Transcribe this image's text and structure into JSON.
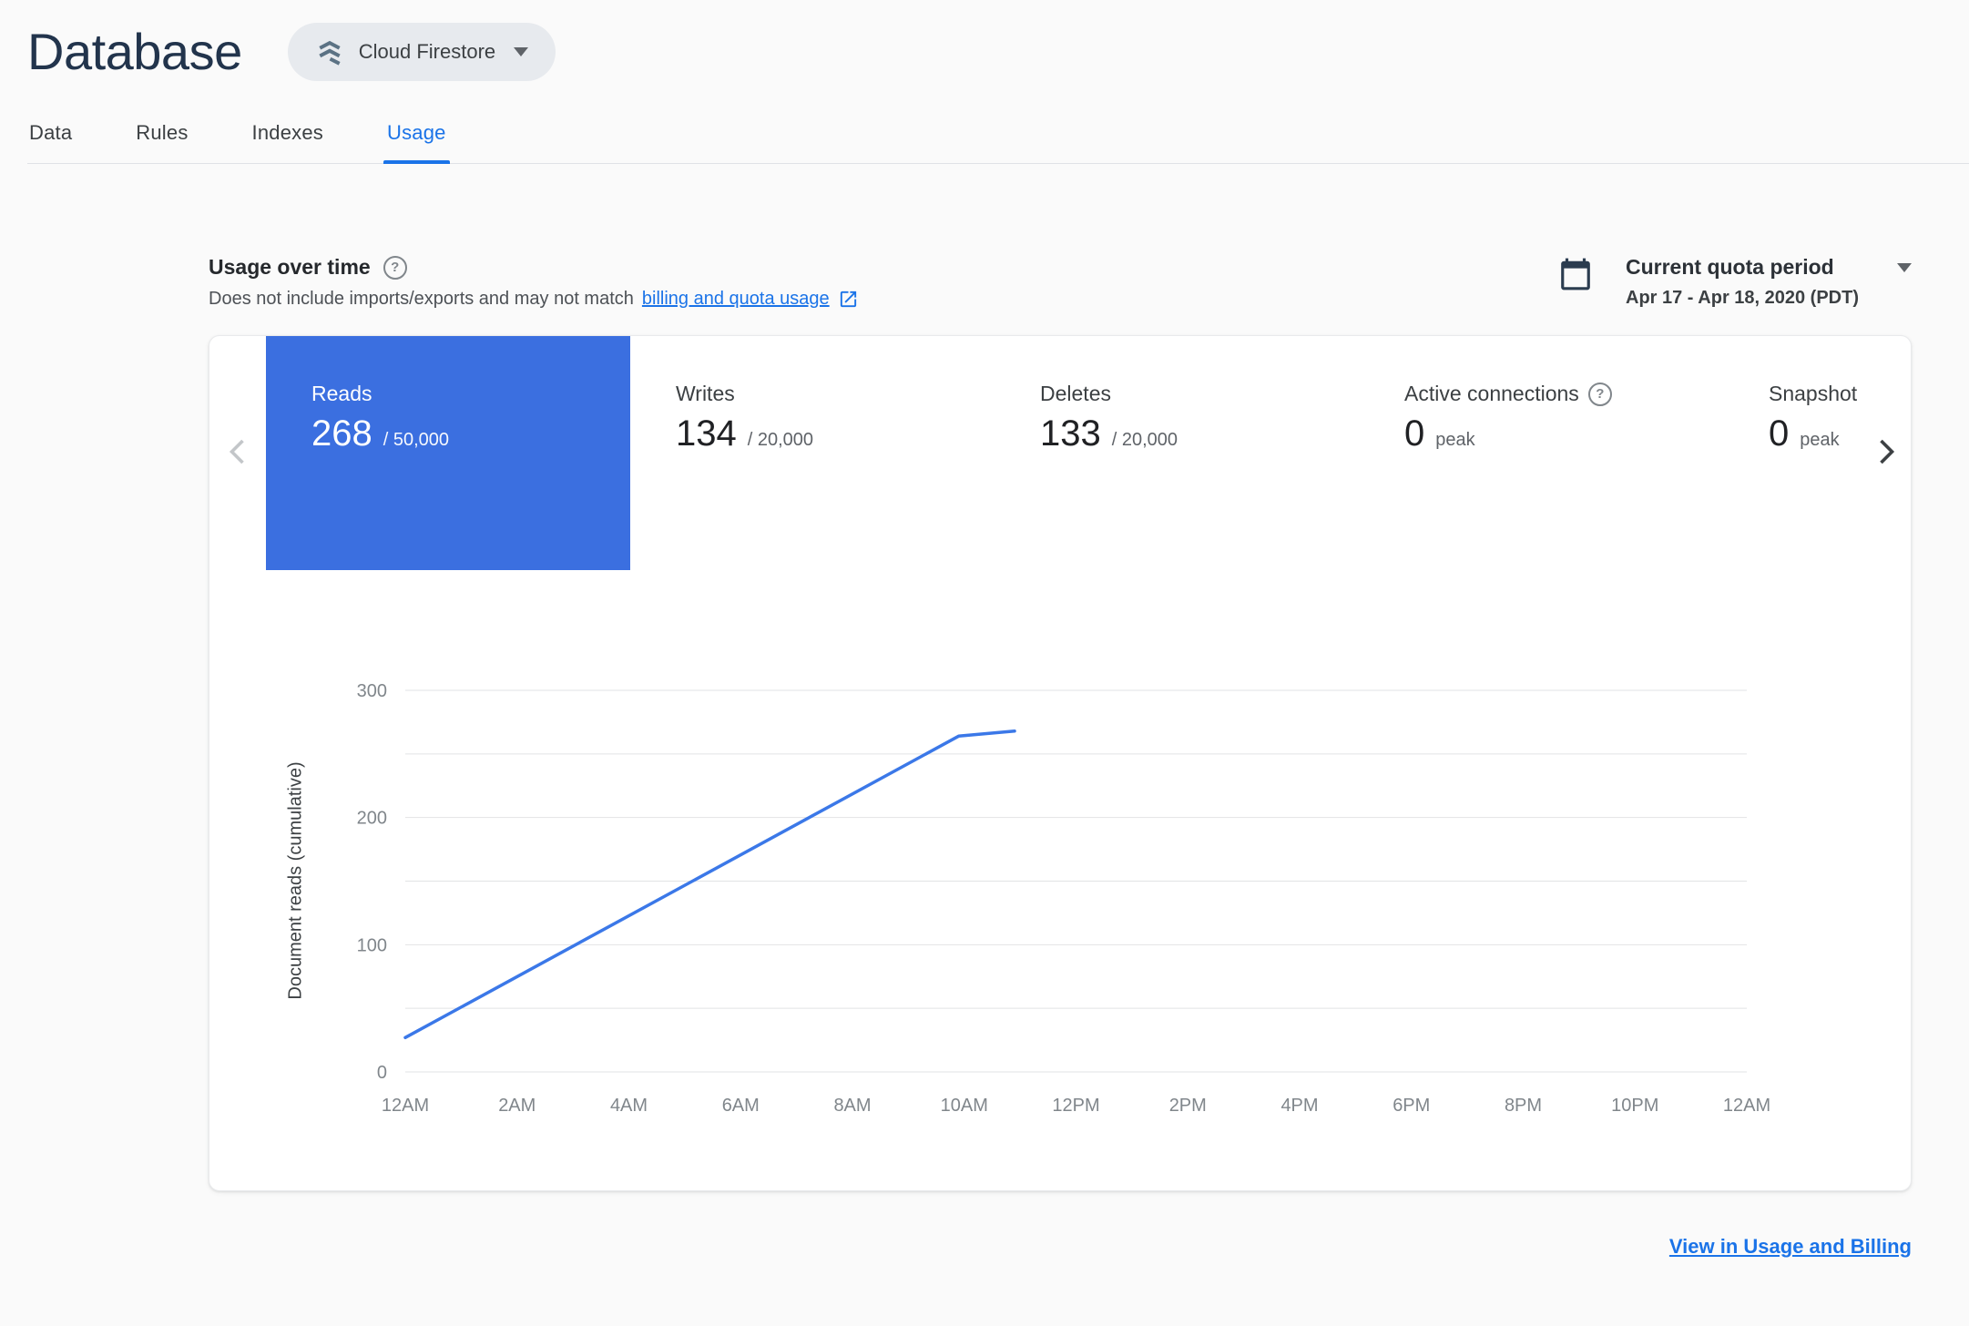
{
  "colors": {
    "accent": "#1a73e8",
    "selected_tile": "#3b6fe0",
    "page_title": "#22344c"
  },
  "header": {
    "title": "Database",
    "product": "Cloud Firestore"
  },
  "tabs": [
    {
      "label": "Data",
      "active": false
    },
    {
      "label": "Rules",
      "active": false
    },
    {
      "label": "Indexes",
      "active": false
    },
    {
      "label": "Usage",
      "active": true
    }
  ],
  "usage_header": {
    "title": "Usage over time",
    "description_prefix": "Does not include imports/exports and may not match ",
    "description_link": "billing and quota usage",
    "quota": {
      "label": "Current quota period",
      "range": "Apr 17 - Apr 18, 2020 (PDT)"
    }
  },
  "metrics": [
    {
      "name": "Reads",
      "value": "268",
      "suffix": "/ 50,000",
      "selected": true
    },
    {
      "name": "Writes",
      "value": "134",
      "suffix": "/ 20,000",
      "selected": false
    },
    {
      "name": "Deletes",
      "value": "133",
      "suffix": "/ 20,000",
      "selected": false
    },
    {
      "name": "Active connections",
      "value": "0",
      "suffix": "peak",
      "selected": false
    },
    {
      "name": "Snapshot listeners",
      "value": "0",
      "suffix": "peak",
      "selected": false
    }
  ],
  "chart_data": {
    "type": "line",
    "title": "",
    "ylabel": "Document reads (cumulative)",
    "xlim_hours": [
      0,
      24
    ],
    "ylim": [
      0,
      300
    ],
    "gridline_step": 50,
    "grid": true,
    "legend": "none",
    "y_ticks": [
      0,
      100,
      200,
      300
    ],
    "x_ticks": [
      "12AM",
      "2AM",
      "4AM",
      "6AM",
      "8AM",
      "10AM",
      "12PM",
      "2PM",
      "4PM",
      "6PM",
      "8PM",
      "10PM",
      "12AM"
    ],
    "series": [
      {
        "name": "Document reads (cumulative)",
        "color": "#3b78e8",
        "points": [
          [
            0,
            27
          ],
          [
            9.9,
            264
          ],
          [
            10.9,
            268
          ]
        ]
      }
    ]
  },
  "footer": {
    "link_label": "View in Usage and Billing"
  }
}
